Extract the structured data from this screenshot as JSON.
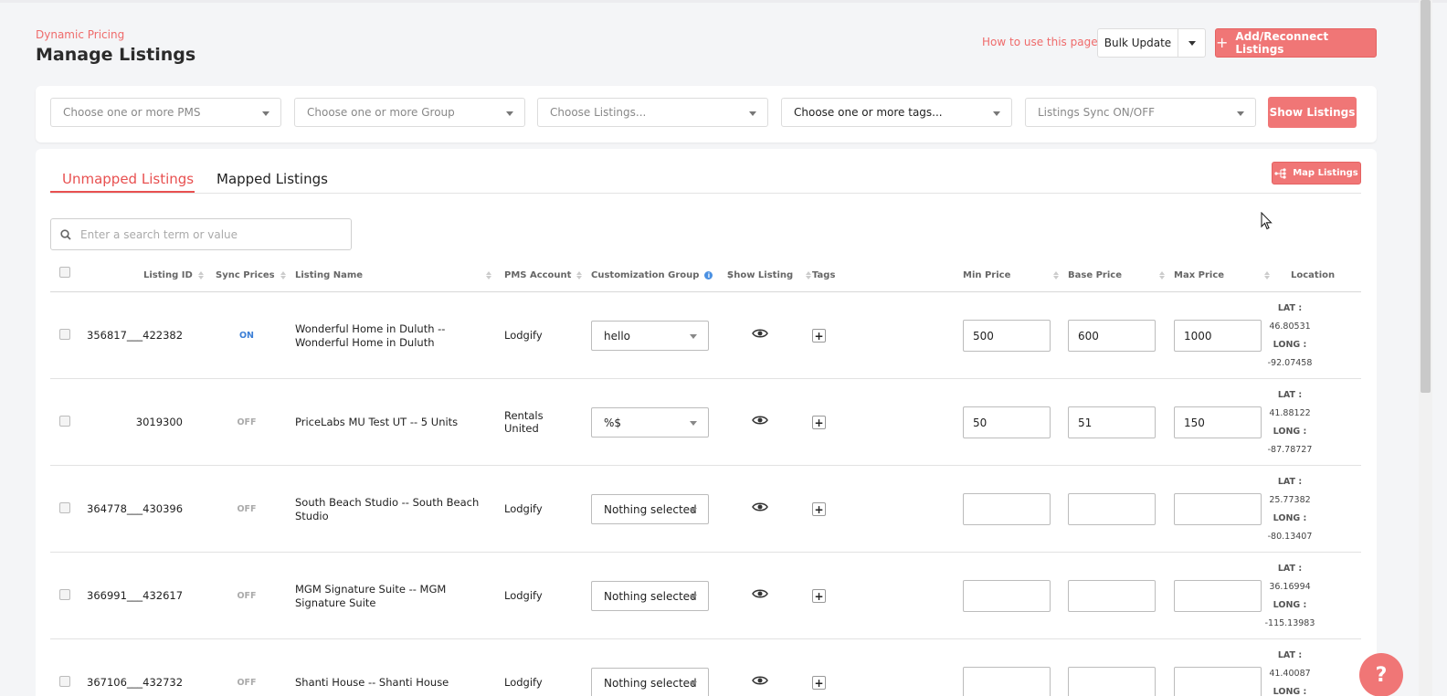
{
  "header": {
    "breadcrumb": "Dynamic Pricing",
    "title": "Manage Listings",
    "help_link": "How to use this page?",
    "bulk_update_label": "Bulk Update",
    "add_reconnect_label": "Add/Reconnect Listings"
  },
  "filters": {
    "pms_placeholder": "Choose one or more PMS",
    "group_placeholder": "Choose one or more Group",
    "listings_placeholder": "Choose Listings...",
    "tags_placeholder": "Choose one or more tags...",
    "sync_placeholder": "Listings Sync ON/OFF",
    "show_listings_label": "Show Listings"
  },
  "tabs": {
    "unmapped": "Unmapped Listings",
    "mapped": "Mapped Listings"
  },
  "map_listings_label": "Map Listings",
  "search": {
    "placeholder": "Enter a search term or value"
  },
  "columns": {
    "listing_id": "Listing ID",
    "sync_prices": "Sync Prices",
    "listing_name": "Listing Name",
    "pms_account": "PMS Account",
    "customization_group": "Customization Group",
    "show_listing": "Show Listing",
    "tags": "Tags",
    "min_price": "Min Price",
    "base_price": "Base Price",
    "max_price": "Max Price",
    "location": "Location"
  },
  "location_labels": {
    "lat": "LAT :",
    "long": "LONG :"
  },
  "rows": [
    {
      "id": "356817___422382",
      "sync": "ON",
      "name": "Wonderful Home in Duluth -- Wonderful Home in Duluth",
      "pms": "Lodgify",
      "group": "hello",
      "min": "500",
      "base": "600",
      "max": "1000",
      "lat": "46.80531",
      "long": "-92.07458"
    },
    {
      "id": "3019300",
      "sync": "OFF",
      "name": "PriceLabs MU Test UT -- 5 Units",
      "pms": "Rentals United",
      "group": "%$",
      "min": "50",
      "base": "51",
      "max": "150",
      "lat": "41.88122",
      "long": "-87.78727"
    },
    {
      "id": "364778___430396",
      "sync": "OFF",
      "name": "South Beach Studio -- South Beach Studio",
      "pms": "Lodgify",
      "group": "Nothing selected",
      "min": "",
      "base": "",
      "max": "",
      "lat": "25.77382",
      "long": "-80.13407"
    },
    {
      "id": "366991___432617",
      "sync": "OFF",
      "name": "MGM Signature Suite -- MGM Signature Suite",
      "pms": "Lodgify",
      "group": "Nothing selected",
      "min": "",
      "base": "",
      "max": "",
      "lat": "36.16994",
      "long": "-115.13983"
    },
    {
      "id": "367106___432732",
      "sync": "OFF",
      "name": "Shanti House -- Shanti House",
      "pms": "Lodgify",
      "group": "Nothing selected",
      "min": "",
      "base": "",
      "max": "",
      "lat": "41.40087",
      "long": ""
    }
  ],
  "help_button": "?",
  "colors": {
    "accent": "#f07676",
    "accent_text": "#e85050",
    "sync_on": "#3c7fd6"
  }
}
